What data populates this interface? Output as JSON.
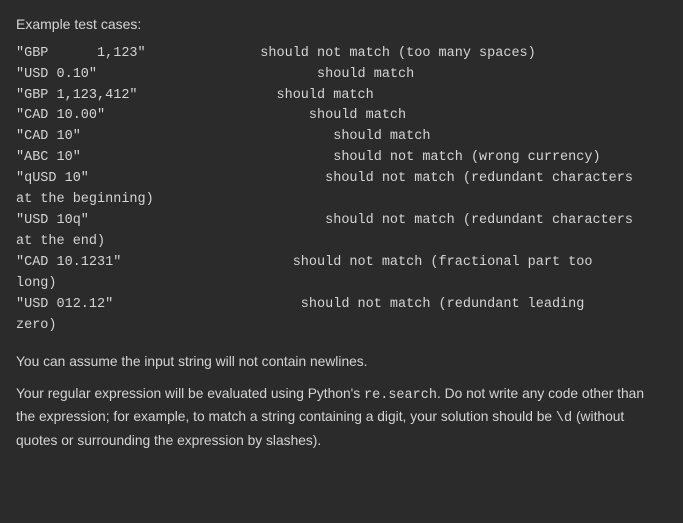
{
  "heading": "Example test cases:",
  "test_cases": [
    {
      "input": "\"GBP      1,123\"",
      "result": "should not match (too many spaces)"
    },
    {
      "input": "\"USD 0.10\"",
      "result": "should match"
    },
    {
      "input": "\"GBP 1,123,412\"",
      "result": "should match"
    },
    {
      "input": "\"CAD 10.00\"",
      "result": "should match"
    },
    {
      "input": "\"CAD 10\"",
      "result": "should match"
    },
    {
      "input": "\"ABC 10\"",
      "result": "should not match (wrong currency)"
    },
    {
      "input": "\"qUSD 10\"",
      "result": "should not match (redundant characters\nat the beginning)"
    },
    {
      "input": "\"USD 10q\"",
      "result": "should not match (redundant characters\nat the end)"
    },
    {
      "input": "\"CAD 10.1231\"",
      "result": "should not match (fractional part too\nlong)"
    },
    {
      "input": "\"USD 012.12\"",
      "result": "should not match (redundant leading\nzero)"
    }
  ],
  "note1": "You can assume the input string will not contain newlines.",
  "note2_part1": "Your regular expression will be evaluated using Python's ",
  "note2_code": "re.search",
  "note2_part2": ". Do not write any code other than the expression; for example, to match a string containing a digit, your solution should be ",
  "note2_code2": "\\d",
  "note2_part3": " (without quotes or surrounding the expression by slashes)."
}
